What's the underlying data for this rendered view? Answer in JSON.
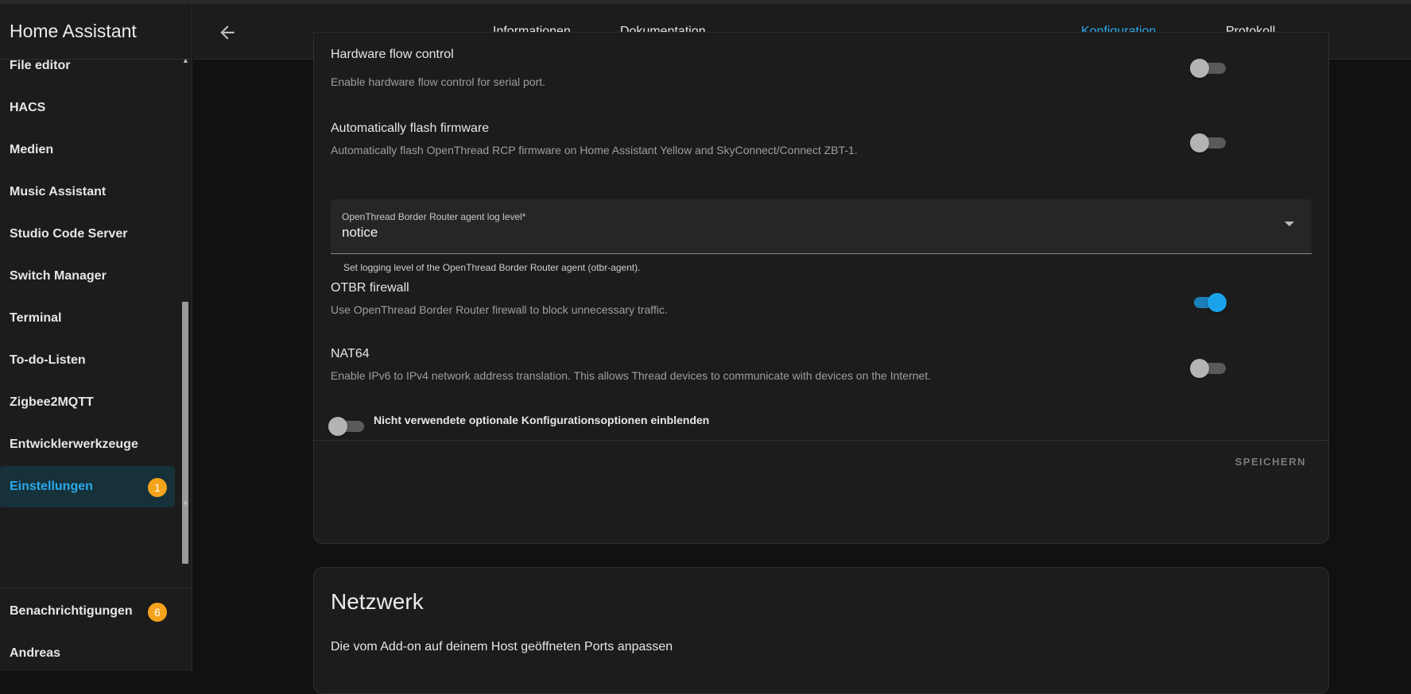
{
  "app": {
    "title": "Home Assistant"
  },
  "sidebar": {
    "items": [
      {
        "label": "File editor"
      },
      {
        "label": "HACS"
      },
      {
        "label": "Medien"
      },
      {
        "label": "Music Assistant"
      },
      {
        "label": "Studio Code Server"
      },
      {
        "label": "Switch Manager"
      },
      {
        "label": "Terminal"
      },
      {
        "label": "To-do-Listen"
      },
      {
        "label": "Zigbee2MQTT"
      },
      {
        "label": "Entwicklerwerkzeuge"
      },
      {
        "label": "Einstellungen",
        "badge": "1",
        "active": true
      }
    ],
    "notifications": {
      "label": "Benachrichtigungen",
      "badge": "6"
    },
    "user": {
      "label": "Andreas"
    }
  },
  "tabs": [
    {
      "label": "Informationen"
    },
    {
      "label": "Dokumentation"
    },
    {
      "label": "Konfiguration",
      "active": true
    },
    {
      "label": "Protokoll"
    }
  ],
  "config": {
    "hardware_flow": {
      "title": "Hardware flow control",
      "desc": "Enable hardware flow control for serial port.",
      "enabled": false
    },
    "auto_flash": {
      "title": "Automatically flash firmware",
      "desc": "Automatically flash OpenThread RCP firmware on Home Assistant Yellow and SkyConnect/Connect ZBT-1.",
      "enabled": false
    },
    "log_level": {
      "label": "OpenThread Border Router agent log level*",
      "value": "notice",
      "helper": "Set logging level of the OpenThread Border Router agent (otbr-agent)."
    },
    "otbr_firewall": {
      "title": "OTBR firewall",
      "desc": "Use OpenThread Border Router firewall to block unnecessary traffic.",
      "enabled": true
    },
    "nat64": {
      "title": "NAT64",
      "desc": "Enable IPv6 to IPv4 network address translation. This allows Thread devices to communicate with devices on the Internet.",
      "enabled": false
    },
    "show_unused": {
      "label": "Nicht verwendete optionale Konfigurationsoptionen einblenden",
      "enabled": false
    },
    "save_label": "SPEICHERN"
  },
  "network": {
    "title": "Netzwerk",
    "subtitle": "Die vom Add-on auf deinem Host geöffneten Ports anpassen"
  },
  "colors": {
    "accent": "#2aa9e9",
    "badge": "#f6a31c",
    "background": "#111111",
    "card": "#1c1c1c"
  }
}
